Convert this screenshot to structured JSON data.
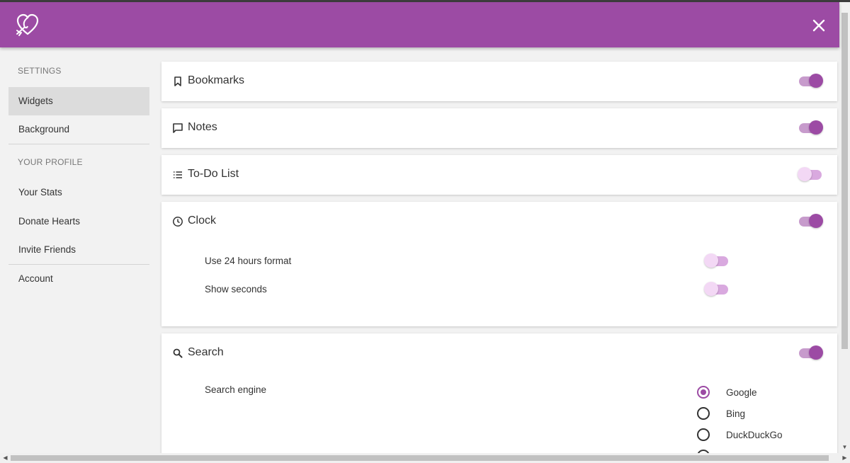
{
  "colors": {
    "accent": "#9c4ba4",
    "toggle_on_track": "#c79bcc",
    "toggle_off_thumb": "#f3d8f5"
  },
  "header": {
    "logo_icon": "heart-logo-icon",
    "close_icon": "close-icon"
  },
  "sidebar": {
    "settings_heading": "SETTINGS",
    "settings_items": [
      {
        "label": "Widgets",
        "active": true
      },
      {
        "label": "Background",
        "active": false
      }
    ],
    "profile_heading": "YOUR PROFILE",
    "profile_items": [
      {
        "label": "Your Stats"
      },
      {
        "label": "Donate Hearts"
      },
      {
        "label": "Invite Friends"
      }
    ],
    "account_item": {
      "label": "Account"
    }
  },
  "widgets": {
    "bookmarks": {
      "title": "Bookmarks",
      "icon": "bookmark-icon",
      "enabled": true
    },
    "notes": {
      "title": "Notes",
      "icon": "comment-icon",
      "enabled": true
    },
    "todo": {
      "title": "To-Do List",
      "icon": "list-icon",
      "enabled": false
    },
    "clock": {
      "title": "Clock",
      "icon": "clock-icon",
      "enabled": true,
      "options": [
        {
          "label": "Use 24 hours format",
          "enabled": false
        },
        {
          "label": "Show seconds",
          "enabled": false
        }
      ]
    },
    "search": {
      "title": "Search",
      "icon": "search-icon",
      "enabled": true,
      "engine_label": "Search engine",
      "engines": [
        {
          "label": "Google",
          "selected": true
        },
        {
          "label": "Bing",
          "selected": false
        },
        {
          "label": "DuckDuckGo",
          "selected": false
        }
      ]
    }
  }
}
